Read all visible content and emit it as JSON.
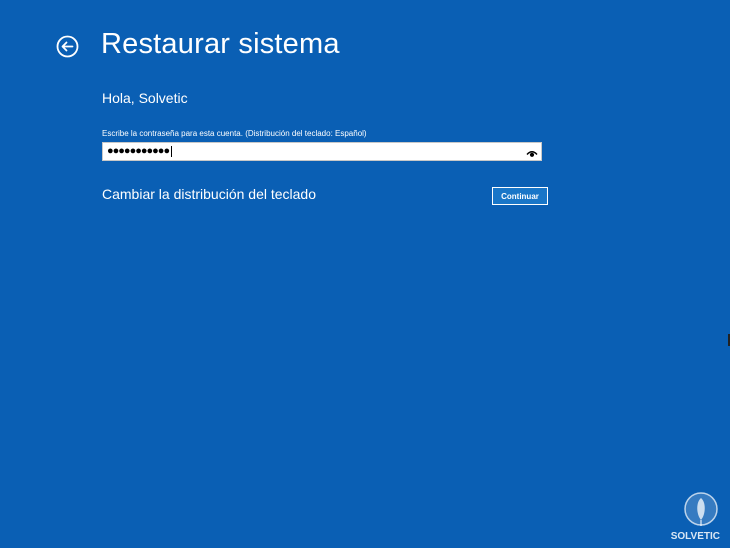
{
  "window": {
    "title": "Restaurar sistema",
    "background_color": "#0a5fb4"
  },
  "nav": {
    "back_icon": "back-arrow-circle-icon"
  },
  "account": {
    "greeting": "Hola, Solvetic"
  },
  "password": {
    "label": "Escribe la contraseña para esta cuenta. (Distribución del teclado: Español)",
    "masked_value": "●●●●●●●●●●●",
    "reveal_icon": "eye-icon"
  },
  "keyboard": {
    "change_layout_label": "Cambiar la distribución del teclado"
  },
  "actions": {
    "continue_label": "Continuar"
  },
  "watermark": {
    "text": "SOLVETIC",
    "icon": "solvetic-logo-icon"
  }
}
